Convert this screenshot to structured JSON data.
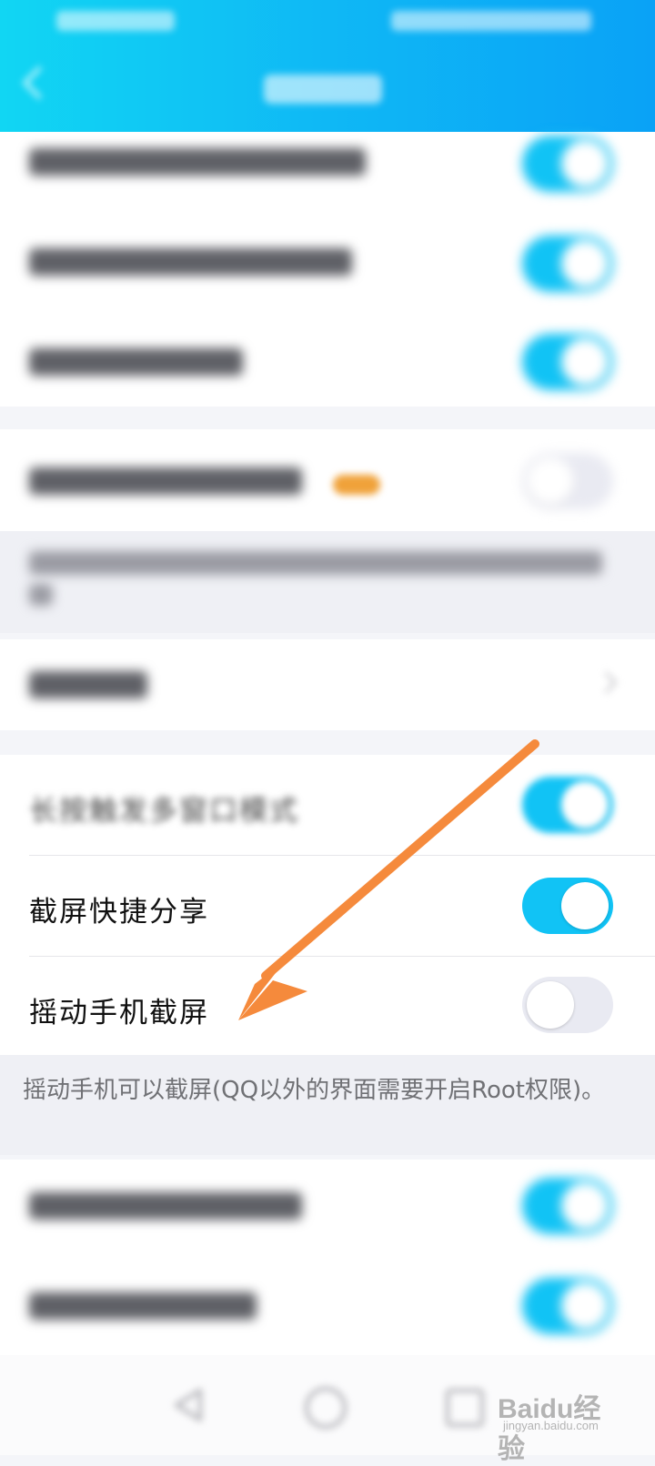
{
  "settings": {
    "screenshot_share_label": "截屏快捷分享",
    "shake_screenshot_label": "摇动手机截屏",
    "shake_screenshot_note": "摇动手机可以截屏(QQ以外的界面需要开启Root权限)。",
    "long_press_multiwindow_label": "长按触发多窗口模式"
  },
  "toggles": {
    "row1": "on",
    "row2": "on",
    "row3": "on",
    "row4": "off",
    "long_press_multiwindow": "on",
    "screenshot_share": "on",
    "shake_screenshot": "off",
    "row_bottom1": "on",
    "row_bottom2": "on"
  },
  "watermark": {
    "text": "Baidu经验",
    "sub": "jingyan.baidu.com"
  },
  "colors": {
    "header_start": "#11d6f3",
    "header_end": "#0aa2f6",
    "toggle_on": "#11c3f5",
    "toggle_off": "#e9eaf2",
    "arrow": "#f58a3c"
  },
  "icons": [
    "back-arrow-icon",
    "chevron-right-icon",
    "nav-back-icon",
    "nav-home-icon",
    "nav-recent-icon",
    "orange-arrow-annotation"
  ]
}
